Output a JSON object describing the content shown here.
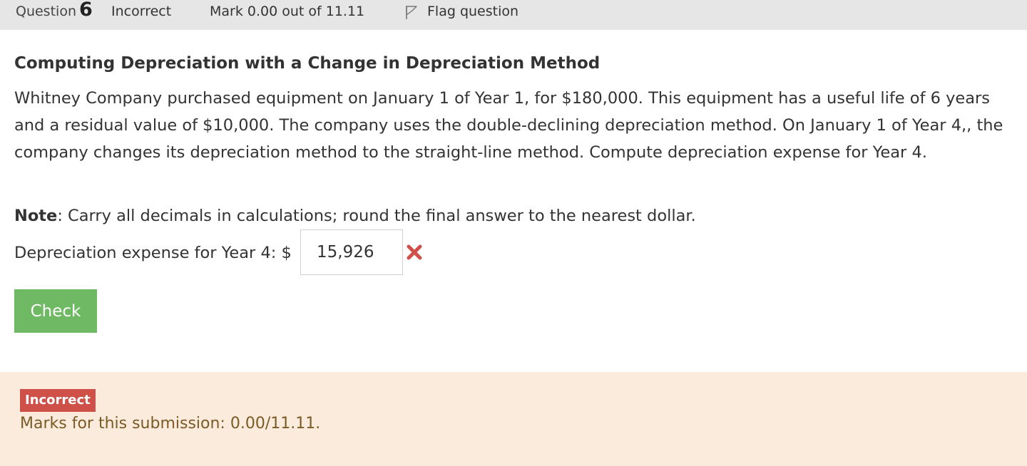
{
  "info": {
    "question_word": "Question",
    "question_number": "6",
    "state": "Incorrect",
    "grade": "Mark 0.00 out of 11.11",
    "flag_label": "Flag question",
    "flag_icon": "flag-icon"
  },
  "question": {
    "title": "Computing Depreciation with a Change in Depreciation Method",
    "text": "Whitney Company purchased equipment on January 1 of Year 1, for $180,000. This equipment has a useful life of 6 years and a residual value of $10,000. The company uses the double-declining depreciation method. On January 1 of Year 4,, the company changes its depreciation method to the straight-line method. Compute depreciation expense for Year 4.",
    "note_label": "Note",
    "note_text": ": Carry all decimals in calculations; round the final answer to the nearest dollar.",
    "answer_label": "Depreciation expense for Year 4: $",
    "answer_value": "15,926",
    "answer_status_icon": "incorrect-x-icon",
    "check_label": "Check"
  },
  "feedback": {
    "badge": "Incorrect",
    "marks_text": "Marks for this submission: 0.00/11.11."
  },
  "colors": {
    "header_bg": "#e6e6e6",
    "check_button": "#6fb864",
    "incorrect_badge": "#cf5048",
    "incorrect_icon": "#cf5048",
    "feedback_bg": "#fbebdc",
    "feedback_text": "#7a5b26"
  }
}
